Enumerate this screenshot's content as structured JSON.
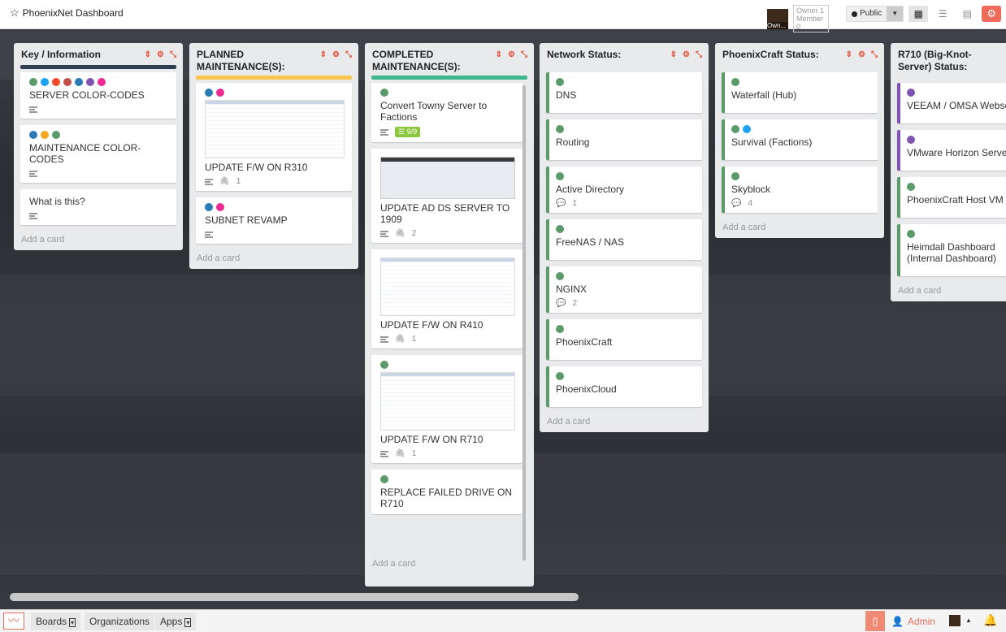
{
  "header": {
    "title": "PhoenixNet Dashboard",
    "owner_pic_label": "Own...",
    "owner_role": "Owner 1",
    "member_role": "Member 0",
    "visibility": "Public"
  },
  "colors": {
    "green": "#5b9a6b",
    "blue": "#1e6fa8",
    "lightblue": "#1da1f2",
    "orange": "#f5a623",
    "red": "#ef4b2a",
    "brown": "#c0504d",
    "purple": "#8055b1",
    "pink": "#ec2b92",
    "darkblue": "#2c7bb6",
    "yellow": "#f8c64c",
    "teal": "#3db88d",
    "navy": "#2f3e50"
  },
  "lists": [
    {
      "title": "Key / Information",
      "add": "Add a card",
      "cards": [
        {
          "title": "SERVER COLOR-CODES"
        },
        {
          "title": "MAINTENANCE COLOR-CODES"
        },
        {
          "title": "What is this?"
        }
      ]
    },
    {
      "title": "PLANNED MAINTENANCE(S):",
      "add": "Add a card",
      "cards": [
        {
          "title": "UPDATE F/W ON R310",
          "attach": "1"
        },
        {
          "title": "SUBNET REVAMP"
        }
      ]
    },
    {
      "title": "COMPLETED MAINTENANCE(S):",
      "add": "Add a card",
      "cards": [
        {
          "title": "Convert Towny Server to Factions",
          "checklist": "9/9"
        },
        {
          "title": "UPDATE AD DS SERVER TO 1909",
          "attach": "2"
        },
        {
          "title": "UPDATE F/W ON R410",
          "attach": "1"
        },
        {
          "title": "UPDATE F/W ON R710",
          "attach": "1"
        },
        {
          "title": "REPLACE FAILED DRIVE ON R710"
        }
      ]
    },
    {
      "title": "Network Status:",
      "add": "Add a card",
      "cards": [
        {
          "title": "DNS"
        },
        {
          "title": "Routing"
        },
        {
          "title": "Active Directory",
          "comments": "1"
        },
        {
          "title": "FreeNAS / NAS"
        },
        {
          "title": "NGINX",
          "comments": "2"
        },
        {
          "title": "PhoenixCraft"
        },
        {
          "title": "PhoenixCloud"
        }
      ]
    },
    {
      "title": "PhoenixCraft Status:",
      "add": "Add a card",
      "cards": [
        {
          "title": "Waterfall (Hub)"
        },
        {
          "title": "Survival (Factions)"
        },
        {
          "title": "Skyblock",
          "comments": "4"
        }
      ]
    },
    {
      "title": "R710 (Big-Knot-Server) Status:",
      "add": "Add a card",
      "cards": [
        {
          "title": "VEEAM / OMSA Webserver"
        },
        {
          "title": "VMware Horizon Server"
        },
        {
          "title": "PhoenixCraft Host VM"
        },
        {
          "title": "Heimdall Dashboard (Internal Dashboard)"
        }
      ]
    }
  ],
  "footer": {
    "boards": "Boards",
    "orgs": "Organizations",
    "apps": "Apps",
    "admin": "Admin"
  }
}
